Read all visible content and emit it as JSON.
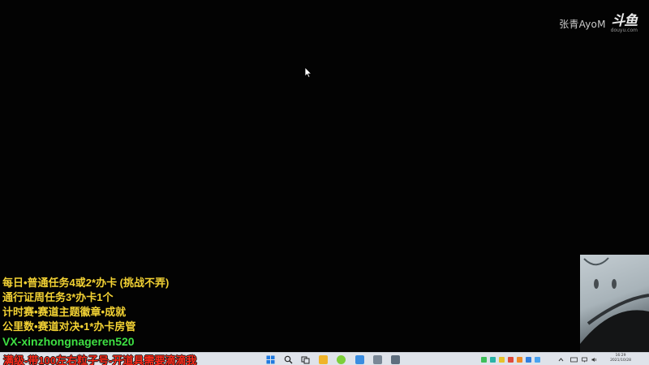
{
  "watermark": {
    "streamer_name": "张青AyoM",
    "logo_text": "斗鱼",
    "logo_url": "douyu.com"
  },
  "overlay": {
    "lines": [
      "每日•普通任务4或2*办卡 (挑战不弄)",
      "通行证周任务3*办卡1个",
      "计时赛•赛道主题徽章•成就",
      "公里数•赛道对决•1*办卡房管",
      "VX-xinzhongnageren520"
    ]
  },
  "promo": {
    "text": "满级-带100左右粒子号-开道具需要滴滴我"
  },
  "taskbar": {
    "pinned_icons": [
      "windows-start-icon",
      "search-icon",
      "task-view-icon",
      "file-explorer-icon",
      "game-app-icon",
      "chat-app-icon",
      "speedtest-app-icon",
      "media-app-icon"
    ],
    "tray_icons": [
      "tray-green-app-icon",
      "tray-teal-app-icon",
      "tray-yellow-app-icon",
      "tray-red-app-icon",
      "tray-orange-app-icon",
      "tray-blue-app-icon",
      "tray-blue2-app-icon",
      "chevron-up-icon",
      "keyboard-icon",
      "network-icon",
      "volume-icon"
    ],
    "clock_time": "16:29",
    "clock_date": "2021/10/28"
  },
  "colors": {
    "overlay_text": "#f3d234",
    "overlay_highlight": "#3ee043",
    "promo_text": "#ff2a1a",
    "taskbar_bg": "#dfe3ea"
  }
}
